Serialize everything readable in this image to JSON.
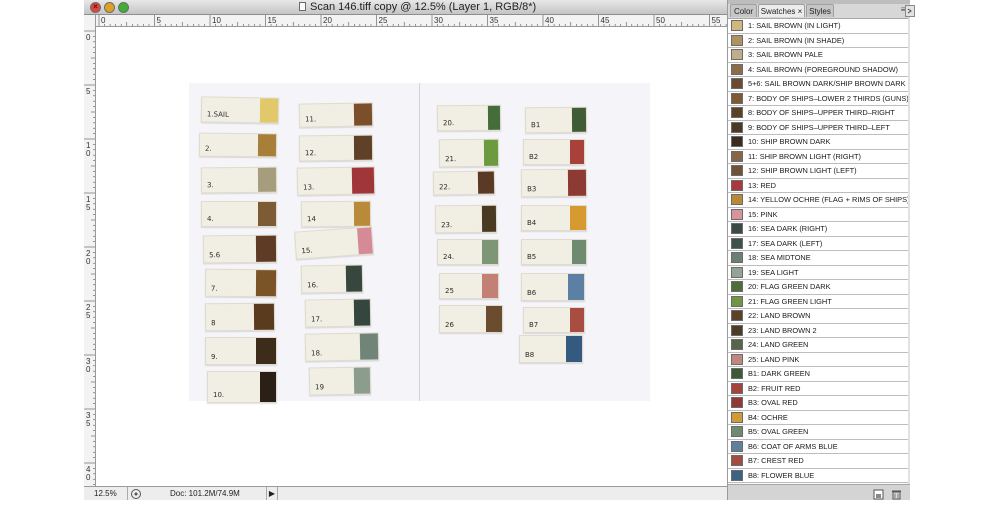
{
  "document": {
    "title": "Scan 146.tiff copy @ 12.5% (Layer 1, RGB/8*)",
    "ruler_h_labels": [
      "0",
      "5",
      "10",
      "15",
      "20",
      "25",
      "30",
      "35",
      "40",
      "45",
      "50",
      "55"
    ],
    "ruler_v_labels": [
      "0",
      "5",
      "1\n0",
      "1\n5",
      "2\n0",
      "2\n5",
      "3\n0",
      "3\n5",
      "4\n0"
    ],
    "status": {
      "zoom": "12.5%",
      "doc_size": "Doc: 101.2M/74.9M",
      "nav_arrow": "▶"
    }
  },
  "scan": {
    "cards": [
      {
        "label": "1.SAIL",
        "color": "#e1c86b"
      },
      {
        "label": "2.",
        "color": "#a87f38"
      },
      {
        "label": "3.",
        "color": "#a69c7e"
      },
      {
        "label": "4.",
        "color": "#7d5b35"
      },
      {
        "label": "5.6",
        "color": "#5e3b25"
      },
      {
        "label": "7.",
        "color": "#7a5327"
      },
      {
        "label": "8",
        "color": "#5b3b1e"
      },
      {
        "label": "9.",
        "color": "#3e2c1a"
      },
      {
        "label": "10.",
        "color": "#2b2016"
      },
      {
        "label": "11.",
        "color": "#7c4f2b"
      },
      {
        "label": "12.",
        "color": "#5f4028"
      },
      {
        "label": "13.",
        "color": "#a1363a"
      },
      {
        "label": "14",
        "color": "#b98a3a"
      },
      {
        "label": "15.",
        "color": "#d58a96"
      },
      {
        "label": "16.",
        "color": "#38473e"
      },
      {
        "label": "17.",
        "color": "#34463e"
      },
      {
        "label": "18.",
        "color": "#718478"
      },
      {
        "label": "19",
        "color": "#8c9d8e"
      },
      {
        "label": "20.",
        "color": "#446d39"
      },
      {
        "label": "21.",
        "color": "#6b9a3f"
      },
      {
        "label": "22.",
        "color": "#5a3a24"
      },
      {
        "label": "23.",
        "color": "#4a3a22"
      },
      {
        "label": "24.",
        "color": "#7f9676"
      },
      {
        "label": "25",
        "color": "#c38175"
      },
      {
        "label": "26",
        "color": "#6a4c2f"
      },
      {
        "label": "B1",
        "color": "#3f5c36"
      },
      {
        "label": "B2",
        "color": "#a8413a"
      },
      {
        "label": "B3",
        "color": "#8c3a33"
      },
      {
        "label": "B4",
        "color": "#d69a31"
      },
      {
        "label": "B5",
        "color": "#6f8b6f"
      },
      {
        "label": "B6",
        "color": "#5c7fa4"
      },
      {
        "label": "B7",
        "color": "#a94d43"
      },
      {
        "label": "B8",
        "color": "#355a80"
      }
    ]
  },
  "panel": {
    "tabs": [
      "Color",
      "Swatches ×",
      "Styles"
    ],
    "menu_icon": "≡",
    "swatches": [
      {
        "name": "1: SAIL BROWN (IN LIGHT)",
        "color": "#d0b67f"
      },
      {
        "name": "2: SAIL BROWN (IN SHADE)",
        "color": "#b09163"
      },
      {
        "name": "3: SAIL BROWN PALE",
        "color": "#c1ad8c"
      },
      {
        "name": "4: SAIL BROWN (FOREGROUND SHADOW)",
        "color": "#8a6c49"
      },
      {
        "name": "5+6: SAIL BROWN DARK/SHIP BROWN DARK",
        "color": "#6a4a33"
      },
      {
        "name": "7: BODY OF SHIPS–LOWER 2 THIRDS (GUNS)",
        "color": "#7d5934"
      },
      {
        "name": "8: BODY OF SHIPS–UPPER THIRD–RIGHT",
        "color": "#5a4128"
      },
      {
        "name": "9: BODY OF SHIPS–UPPER THIRD–LEFT",
        "color": "#4a3a25"
      },
      {
        "name": "10: SHIP BROWN DARK",
        "color": "#3b2c1f"
      },
      {
        "name": "11: SHIP BROWN LIGHT (RIGHT)",
        "color": "#866646"
      },
      {
        "name": "12: SHIP BROWN LIGHT (LEFT)",
        "color": "#6f5238"
      },
      {
        "name": "13: RED",
        "color": "#a8383c"
      },
      {
        "name": "14: YELLOW OCHRE (FLAG + RIMS OF SHIPS)",
        "color": "#b9893a"
      },
      {
        "name": "15: PINK",
        "color": "#d8949b"
      },
      {
        "name": "16: SEA DARK (RIGHT)",
        "color": "#3b4a44"
      },
      {
        "name": "17: SEA DARK (LEFT)",
        "color": "#3e5249"
      },
      {
        "name": "18: SEA MIDTONE",
        "color": "#6c7f75"
      },
      {
        "name": "19: SEA LIGHT",
        "color": "#93a395"
      },
      {
        "name": "20: FLAG GREEN DARK",
        "color": "#4d6e3b"
      },
      {
        "name": "21: FLAG GREEN LIGHT",
        "color": "#6e9645"
      },
      {
        "name": "22: LAND BROWN",
        "color": "#5b4228"
      },
      {
        "name": "23: LAND BROWN 2",
        "color": "#4d3d27"
      },
      {
        "name": "24: LAND GREEN",
        "color": "#57654b"
      },
      {
        "name": "25: LAND PINK",
        "color": "#c0877f"
      },
      {
        "name": "B1: DARK GREEN",
        "color": "#3e5936"
      },
      {
        "name": "B2: FRUIT RED",
        "color": "#a6423d"
      },
      {
        "name": "B3: OVAL RED",
        "color": "#8f3a35"
      },
      {
        "name": "B4: OCHRE",
        "color": "#d19a37"
      },
      {
        "name": "B5: OVAL GREEN",
        "color": "#6e8a70"
      },
      {
        "name": "B6: COAT OF ARMS BLUE",
        "color": "#5f7f9f"
      },
      {
        "name": "B7: CREST RED",
        "color": "#a44b42"
      },
      {
        "name": "B8: FLOWER BLUE",
        "color": "#3f6184"
      }
    ],
    "footer_icons": [
      "new-swatch-icon",
      "trash-icon"
    ]
  }
}
